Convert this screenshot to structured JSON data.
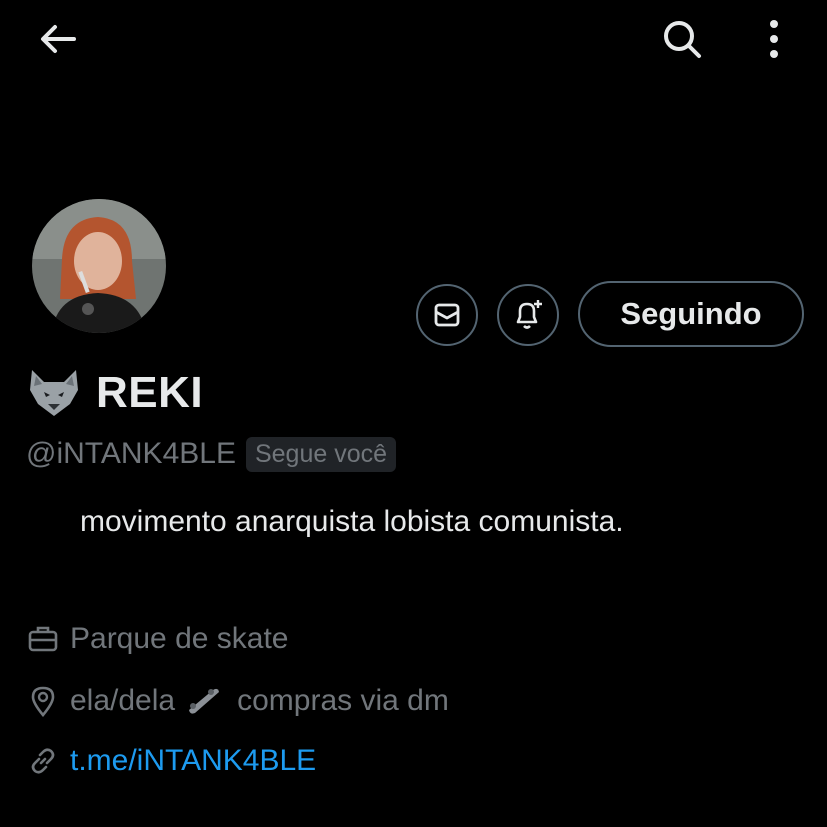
{
  "header": {
    "back_icon": "arrow-left-icon",
    "search_icon": "search-icon",
    "more_icon": "more-vertical-icon"
  },
  "profile": {
    "avatar": "profile-avatar",
    "name_emoji": "wolf-icon",
    "name": "REKI",
    "handle": "@iNTANK4BLE",
    "follows_you": "Segue você",
    "bio": "movimento anarquista lobista comunista."
  },
  "actions": {
    "message_icon": "envelope-icon",
    "notify_icon": "bell-plus-icon",
    "follow_label": "Seguindo"
  },
  "details": {
    "category": "Parque de skate",
    "location_part1": "ela/dela",
    "location_part2": "compras via dm",
    "link": "t.me/iNTANK4BLE"
  },
  "colors": {
    "background": "#000000",
    "text_primary": "#e7e9ea",
    "text_secondary": "#71767b",
    "link": "#1d9bf0",
    "border": "#536471"
  }
}
